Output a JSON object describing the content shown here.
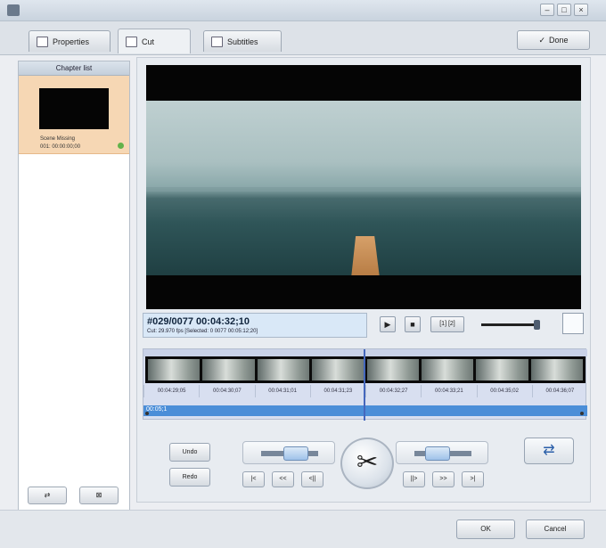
{
  "window": {
    "title": "",
    "controls": {
      "minimize": "–",
      "maximize": "□",
      "close": "×"
    }
  },
  "tabs": [
    {
      "label": "Properties",
      "icon": "properties-icon"
    },
    {
      "label": "Cut",
      "icon": "cut-icon"
    },
    {
      "label": "Subtitles",
      "icon": "subtitles-icon"
    }
  ],
  "done_button": {
    "label": "Done",
    "icon": "done-icon"
  },
  "chapter_panel": {
    "header": "Chapter list",
    "items": [
      {
        "name": "Scene Missing",
        "timecode": "001: 00:00:00;00"
      }
    ],
    "buttons": [
      "⇄",
      "⊠"
    ]
  },
  "player": {
    "timecode": "#029/0077 00:04:32;10",
    "details": "Cut: 29.970 fps  [Selected: 0  0077  00:05:12;20]",
    "buttons": {
      "play": "▶",
      "stop": "■",
      "clip": "[1] [2]"
    },
    "volume_level": 0.96,
    "fullscreen_icon": "fullscreen-icon"
  },
  "timeline": {
    "timecodes": [
      "00:04:29;05",
      "00:04:30;07",
      "00:04:31;01",
      "00:04:31;23",
      "00:04:32;27",
      "00:04:33;21",
      "00:04:35;02",
      "00:04:36;07"
    ],
    "selection_label": "00:05;1"
  },
  "edit_controls": {
    "left_buttons": [
      "Undo",
      "Redo"
    ],
    "center_steps_left": [
      "|<",
      "<<",
      "<||"
    ],
    "center_steps_right": [
      "||>",
      ">>",
      ">|"
    ],
    "scissors_icon": "scissors-icon",
    "arrow_icon": "split-arrow-icon"
  },
  "footer": {
    "ok": "OK",
    "cancel": "Cancel"
  }
}
